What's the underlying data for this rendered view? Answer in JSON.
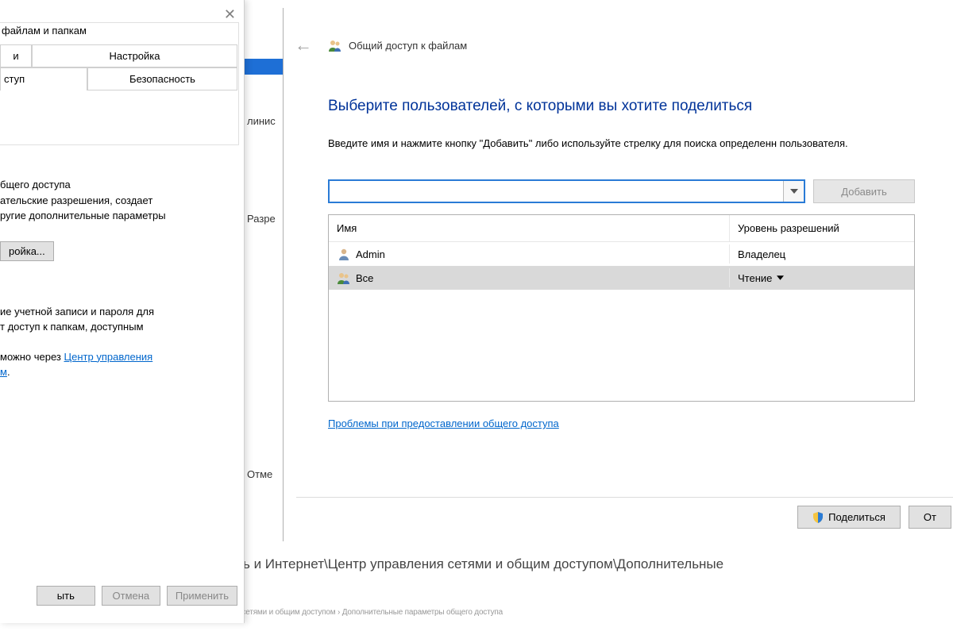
{
  "properties_dialog": {
    "tabs_row1": {
      "left": "и",
      "right": "Настройка"
    },
    "tabs_row2": {
      "left": "ступ",
      "right": "Безопасность"
    },
    "line_files_folders": "файлам и папкам",
    "line_access": "туп",
    "advanced_heading": "бщего доступа",
    "advanced_line1": "ательские разрешения, создает",
    "advanced_line2": "ругие дополнительные параметры",
    "advanced_btn": "ройка...",
    "protect_line1": "ие учетной записи и пароля для",
    "protect_line2": "т доступ к папкам, доступным",
    "protect_line3_a": "можно через ",
    "protect_link": "Центр управления",
    "protect_line4": "м",
    "buttons": {
      "close": "ыть",
      "cancel": "Отмена",
      "apply": "Применить"
    }
  },
  "behind": {
    "linis": "линис",
    "razre": "Разре",
    "otme": "Отме",
    "bottom_path": "ь и Интернет\\Центр управления сетями и общим доступом\\Дополнительные",
    "crumbs": "→  ↑  ←  Панель управления  ›  Сеть и Интернет  ›  Центр управления сетями и общим доступом  ›  Дополнительные параметры общего доступа"
  },
  "share": {
    "title": "Общий доступ к файлам",
    "heading": "Выберите пользователей, с которыми вы хотите поделиться",
    "description": "Введите имя и нажмите кнопку \"Добавить\" либо используйте стрелку для поиска определенн пользователя.",
    "add_button": "Добавить",
    "columns": {
      "name": "Имя",
      "perm": "Уровень разрешений"
    },
    "users": [
      {
        "name": "Admin",
        "perm": "Владелец",
        "selected": false,
        "type": "user"
      },
      {
        "name": "Все",
        "perm": "Чтение",
        "selected": true,
        "type": "group"
      }
    ],
    "trouble_link": "Проблемы при предоставлении общего доступа",
    "share_button": "Поделиться",
    "cancel_button": "От"
  }
}
